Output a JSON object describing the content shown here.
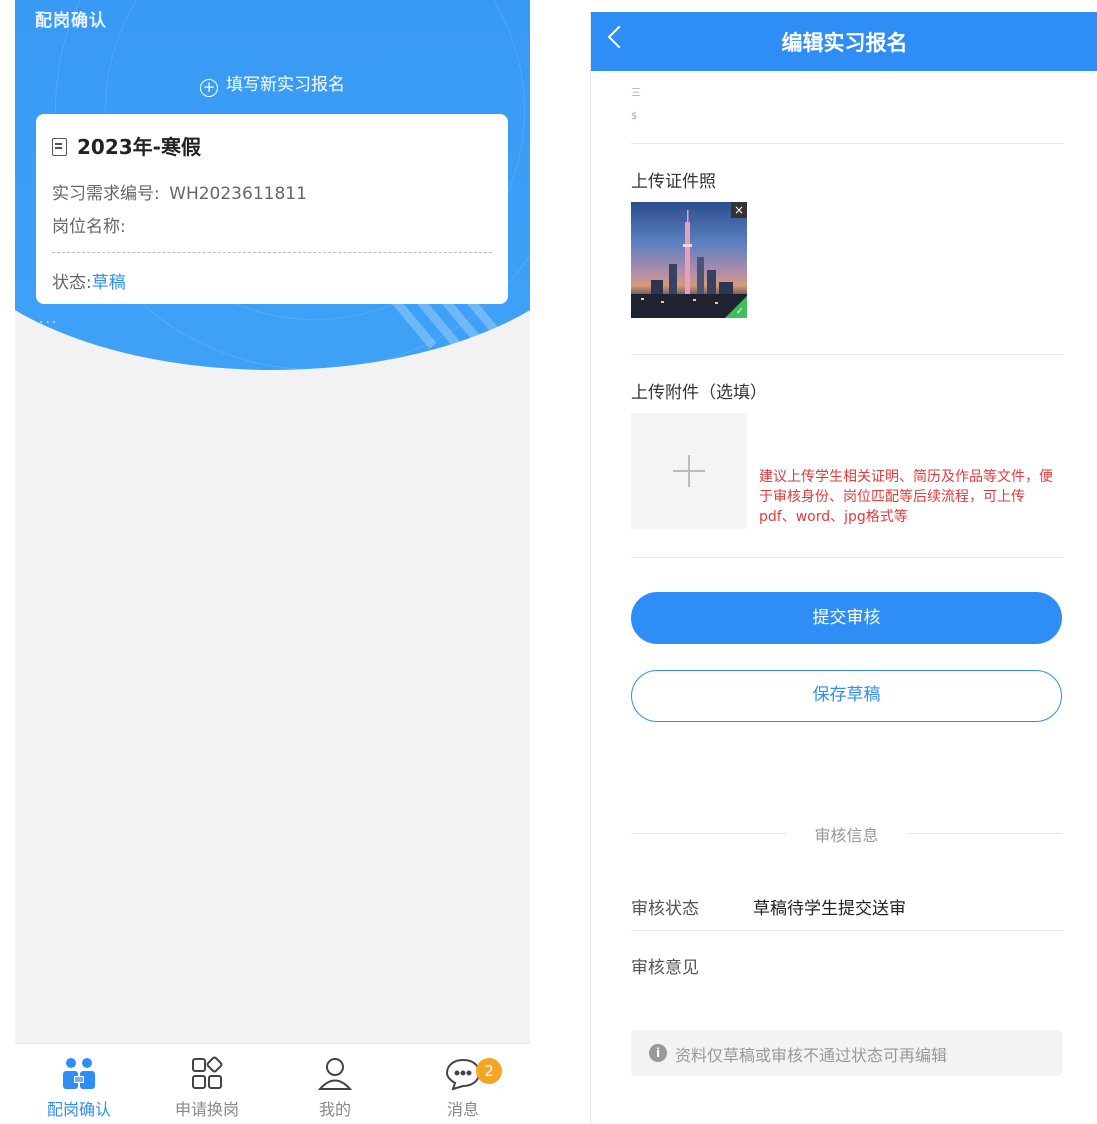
{
  "left": {
    "header_title": "配岗确认",
    "add_new_label": "填写新实习报名",
    "card": {
      "title": "2023年-寒假",
      "req_no_label": "实习需求编号:",
      "req_no_value": "WH2023611811",
      "position_label": "岗位名称:",
      "status_label": "状态:",
      "status_value": "草稿"
    },
    "tabs": [
      {
        "label": "配岗确认",
        "icon": "people-icon",
        "active": true
      },
      {
        "label": "申请换岗",
        "icon": "grid-icon",
        "active": false
      },
      {
        "label": "我的",
        "icon": "user-icon",
        "active": false
      },
      {
        "label": "消息",
        "icon": "chat-icon",
        "active": false
      }
    ],
    "message_badge": "2"
  },
  "right": {
    "nav_title": "编辑实习报名",
    "faint_line_1": "三",
    "faint_line_2": "$",
    "upload_id_label": "上传证件照",
    "upload_attachment_label": "上传附件（选填）",
    "attachment_hint": "建议上传学生相关证明、简历及作品等文件，便于审核身份、岗位匹配等后续流程，可上传pdf、word、jpg格式等",
    "submit_label": "提交审核",
    "save_label": "保存草稿",
    "review_section_title": "审核信息",
    "review_status_label": "审核状态",
    "review_status_value": "草稿待学生提交送审",
    "review_opinion_label": "审核意见",
    "note": "资料仅草稿或审核不通过状态可再编辑"
  },
  "colors": {
    "primary": "#2f8ef5",
    "hint_red": "#e23b3b",
    "badge": "#f5a524"
  }
}
